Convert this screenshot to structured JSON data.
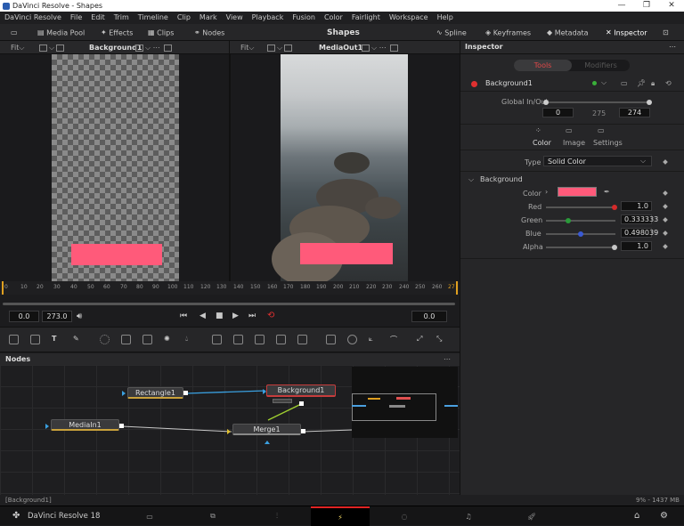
{
  "window": {
    "title": "DaVinci Resolve - Shapes"
  },
  "menu": [
    "DaVinci Resolve",
    "File",
    "Edit",
    "Trim",
    "Timeline",
    "Clip",
    "Mark",
    "View",
    "Playback",
    "Fusion",
    "Color",
    "Fairlight",
    "Workspace",
    "Help"
  ],
  "toolbar": {
    "media_pool": "Media Pool",
    "effects": "Effects",
    "clips": "Clips",
    "nodes": "Nodes",
    "title": "Shapes",
    "spline": "Spline",
    "keyframes": "Keyframes",
    "metadata": "Metadata",
    "inspector": "Inspector"
  },
  "viewer_left": {
    "fit": "Fit",
    "name": "Background1"
  },
  "viewer_right": {
    "fit": "Fit",
    "name": "MediaOut1"
  },
  "ruler": {
    "ticks": [
      "0",
      "10",
      "20",
      "30",
      "40",
      "50",
      "60",
      "70",
      "80",
      "90",
      "100",
      "110",
      "120",
      "130",
      "140",
      "150",
      "160",
      "170",
      "180",
      "190",
      "200",
      "210",
      "220",
      "230",
      "240",
      "250",
      "260",
      "27"
    ]
  },
  "transport": {
    "start": "0.0",
    "end": "273.0",
    "current": "0.0"
  },
  "nodes_panel": {
    "title": "Nodes",
    "nodes": {
      "rectangle": "Rectangle1",
      "background": "Background1",
      "mediain": "MediaIn1",
      "merge": "Merge1"
    }
  },
  "inspector": {
    "title": "Inspector",
    "tabs": {
      "tools": "Tools",
      "modifiers": "Modifiers"
    },
    "node_name": "Background1",
    "global_inout": {
      "label": "Global In/Out",
      "in": "0",
      "mid": "275",
      "out": "274"
    },
    "subtabs": {
      "color": "Color",
      "image": "Image",
      "settings": "Settings"
    },
    "type": {
      "label": "Type",
      "value": "Solid Color"
    },
    "section": "Background",
    "color_label": "Color",
    "swatch_color": "#ff5a7a",
    "channels": [
      {
        "label": "Red",
        "value": "1.0",
        "knob": "#d42a2a"
      },
      {
        "label": "Green",
        "value": "0.333333",
        "knob": "#2a9a3a"
      },
      {
        "label": "Blue",
        "value": "0.498039",
        "knob": "#3a5ad4"
      },
      {
        "label": "Alpha",
        "value": "1.0",
        "knob": "#c8c8c8"
      }
    ]
  },
  "status": {
    "left": "[Background1]",
    "right": "9% - 1437 MB"
  },
  "pages_bar": {
    "app": "DaVinci Resolve 18"
  }
}
